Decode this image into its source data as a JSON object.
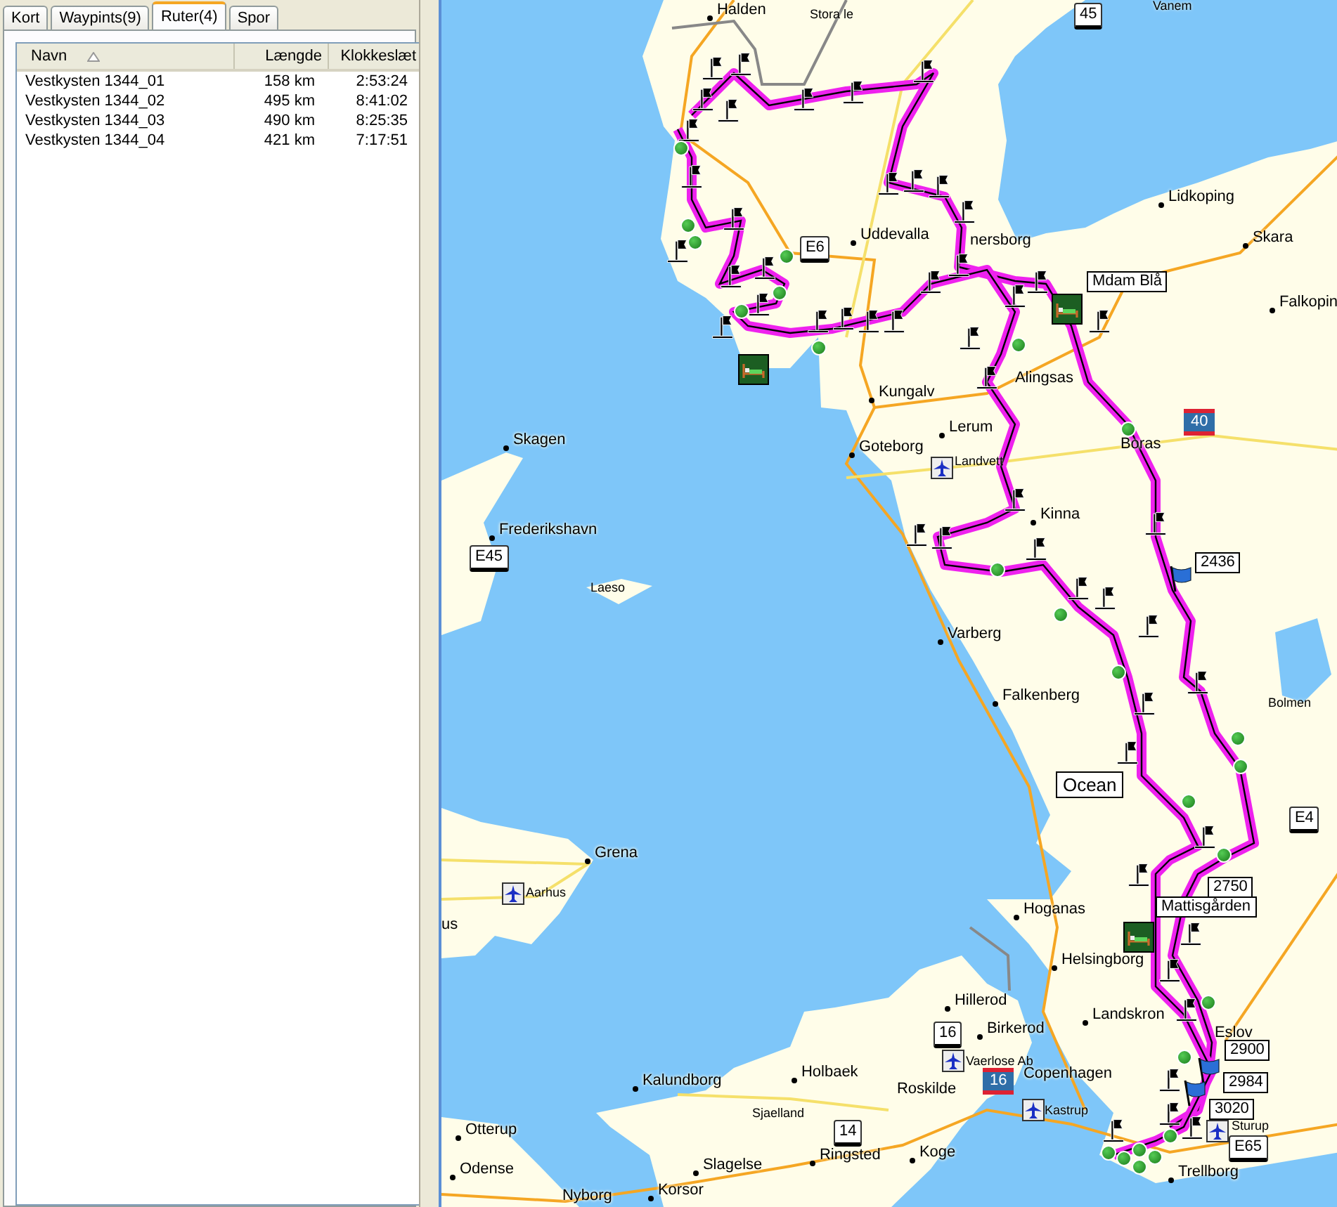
{
  "tabs": [
    {
      "label": "Kort",
      "selected": false
    },
    {
      "label": "Waypints(9)",
      "selected": false
    },
    {
      "label": "Ruter(4)",
      "selected": true
    },
    {
      "label": "Spor",
      "selected": false
    }
  ],
  "routes": {
    "columns": [
      "Navn",
      "Længde",
      "Klokkeslæt"
    ],
    "rows": [
      {
        "name": "Vestkysten 1344_01",
        "length": "158 km",
        "time": "2:53:24"
      },
      {
        "name": "Vestkysten 1344_02",
        "length": "495 km",
        "time": "8:41:02"
      },
      {
        "name": "Vestkysten 1344_03",
        "length": "490 km",
        "time": "8:25:35"
      },
      {
        "name": "Vestkysten 1344_04",
        "length": "421 km",
        "time": "7:17:51"
      }
    ]
  },
  "map": {
    "labels": [
      {
        "text": "Halden",
        "kind": "city"
      },
      {
        "text": "Stora le",
        "kind": "small"
      },
      {
        "text": "Vanem",
        "kind": "small"
      },
      {
        "text": "45",
        "kind": "shield"
      },
      {
        "text": "Uddevalla",
        "kind": "city"
      },
      {
        "text": "E6",
        "kind": "shield"
      },
      {
        "text": "nersborg",
        "kind": "text"
      },
      {
        "text": "Lidkoping",
        "kind": "city"
      },
      {
        "text": "Skara",
        "kind": "city"
      },
      {
        "text": "Falkopin",
        "kind": "city"
      },
      {
        "text": "Mdam Blå",
        "kind": "box"
      },
      {
        "text": "Kungalv",
        "kind": "city"
      },
      {
        "text": "Lerum",
        "kind": "city"
      },
      {
        "text": "Goteborg",
        "kind": "city"
      },
      {
        "text": "Landvett",
        "kind": "small"
      },
      {
        "text": "Alingsas",
        "kind": "text"
      },
      {
        "text": "Boras",
        "kind": "text"
      },
      {
        "text": "40",
        "kind": "interstate"
      },
      {
        "text": "Kinna",
        "kind": "city"
      },
      {
        "text": "2436",
        "kind": "box"
      },
      {
        "text": "Skagen",
        "kind": "city"
      },
      {
        "text": "Frederikshavn",
        "kind": "city"
      },
      {
        "text": "E45",
        "kind": "shield"
      },
      {
        "text": "Laeso",
        "kind": "small"
      },
      {
        "text": "Varberg",
        "kind": "city"
      },
      {
        "text": "Falkenberg",
        "kind": "city"
      },
      {
        "text": "Bolmen",
        "kind": "small"
      },
      {
        "text": "Ocean",
        "kind": "area"
      },
      {
        "text": "E4",
        "kind": "shield"
      },
      {
        "text": "2750",
        "kind": "box"
      },
      {
        "text": "Mattisgården",
        "kind": "box"
      },
      {
        "text": "Hoganas",
        "kind": "city"
      },
      {
        "text": "Helsingborg",
        "kind": "city"
      },
      {
        "text": "Landskron",
        "kind": "city"
      },
      {
        "text": "Eslov",
        "kind": "text"
      },
      {
        "text": "2900",
        "kind": "box"
      },
      {
        "text": "2984",
        "kind": "box"
      },
      {
        "text": "3020",
        "kind": "box"
      },
      {
        "text": "Sturup",
        "kind": "small"
      },
      {
        "text": "E65",
        "kind": "shield"
      },
      {
        "text": "Trellborg",
        "kind": "city"
      },
      {
        "text": "Grena",
        "kind": "city"
      },
      {
        "text": "Aarhus",
        "kind": "small"
      },
      {
        "text": "us",
        "kind": "text"
      },
      {
        "text": "Hillerod",
        "kind": "city"
      },
      {
        "text": "16",
        "kind": "shield"
      },
      {
        "text": "Birkerod",
        "kind": "city"
      },
      {
        "text": "Vaerlose Ab",
        "kind": "small"
      },
      {
        "text": "16",
        "kind": "interstate"
      },
      {
        "text": "Copenhagen",
        "kind": "text"
      },
      {
        "text": "Kastrup",
        "kind": "small"
      },
      {
        "text": "Roskilde",
        "kind": "text"
      },
      {
        "text": "Koge",
        "kind": "city"
      },
      {
        "text": "Holbaek",
        "kind": "city"
      },
      {
        "text": "Kalundborg",
        "kind": "city"
      },
      {
        "text": "Sjaelland",
        "kind": "small"
      },
      {
        "text": "14",
        "kind": "shield"
      },
      {
        "text": "Ringsted",
        "kind": "city"
      },
      {
        "text": "Otterup",
        "kind": "city"
      },
      {
        "text": "Odense",
        "kind": "city"
      },
      {
        "text": "Nyborg",
        "kind": "text"
      },
      {
        "text": "Korsor",
        "kind": "city"
      },
      {
        "text": "Slagelse",
        "kind": "city"
      }
    ]
  }
}
